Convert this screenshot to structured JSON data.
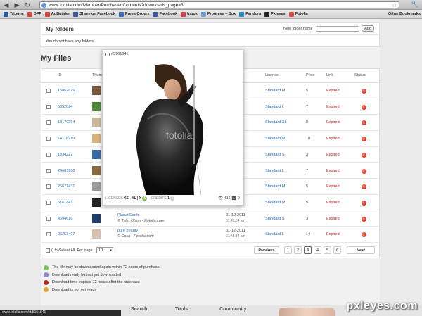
{
  "browser": {
    "url": "www.fotolia.com/Member/PurchasedContents?downloads_page=3",
    "bookmarks": [
      "Tribune",
      "DFP",
      "AdBuilder",
      "Share on Facebook",
      "Press Orders",
      "Facebook",
      "Inbox",
      "Progress – Box",
      "Pandora",
      "Pxleyes",
      "Fotolia"
    ],
    "other_bookmarks": "Other Bookmarks",
    "status_url": "www.fotolia.com/id/5161841"
  },
  "folders": {
    "title": "My folders",
    "new_folder_label": "New folder name",
    "add_label": "Add",
    "empty_text": "You do not have any folders"
  },
  "files": {
    "title": "My Files",
    "columns": {
      "id": "ID",
      "thumbnail": "Thumbnail",
      "license": "License",
      "price": "Price",
      "link": "Link",
      "status": "Status"
    },
    "rows": [
      {
        "id": "15862629",
        "desc": "",
        "author": "",
        "date": "",
        "time": "",
        "license": "Standard M",
        "price": "5",
        "link": "Expired",
        "thumb": "#7a5a3a"
      },
      {
        "id": "6352024",
        "desc": "",
        "author": "",
        "date": "01",
        "time": "",
        "license": "Standard L",
        "price": "7",
        "link": "Expired",
        "thumb": "#4e8a3c"
      },
      {
        "id": "18170394",
        "desc": "",
        "author": "",
        "date": "",
        "time": "",
        "license": "Standard XL",
        "price": "8",
        "link": "Expired",
        "thumb": "#c9b99a"
      },
      {
        "id": "14116279",
        "desc": "",
        "author": "",
        "date": "01",
        "time": "",
        "license": "Standard M",
        "price": "10",
        "link": "Expired",
        "thumb": "#d9b07a"
      },
      {
        "id": "1834227",
        "desc": "",
        "author": "",
        "date": "",
        "time": "",
        "license": "Standard S",
        "price": "3",
        "link": "Expired",
        "thumb": "#3a6aa8"
      },
      {
        "id": "24003900",
        "desc": "",
        "author": "",
        "date": "",
        "time": "",
        "license": "Standard L",
        "price": "7",
        "link": "Expired",
        "thumb": "#8a6a3a"
      },
      {
        "id": "25671431",
        "desc": "",
        "author": "",
        "date": "01",
        "time": "",
        "license": "Standard M",
        "price": "5",
        "link": "Expired",
        "thumb": "#9a9a9a"
      },
      {
        "id": "5161841",
        "desc": "",
        "author": "© diiiz - Fotolia.com",
        "date": "",
        "time": "",
        "license": "Standard M",
        "price": "5",
        "link": "Expired",
        "thumb": "#222222"
      },
      {
        "id": "4694616",
        "desc": "Planet Earth",
        "author": "© Tyler Olson - Fotolia.com",
        "date": "01-12-2011",
        "time": "01:45:34 am",
        "license": "Standard S",
        "price": "3",
        "link": "Expired",
        "thumb": "#1b3b6b"
      },
      {
        "id": "26253407",
        "desc": "pure beauty",
        "author": "© Coka - Fotolia.com",
        "date": "01-12-2011",
        "time": "01:45:34 am",
        "license": "Standard L",
        "price": "14",
        "link": "Expired",
        "thumb": "#d8c0b0"
      }
    ],
    "select_all_label": "(Un)Select All",
    "per_page_label": "Per page",
    "per_page_value": "10",
    "pagination": {
      "previous": "Previous",
      "pages": [
        "1",
        "2",
        "3",
        "4",
        "5",
        "6"
      ],
      "current": "3",
      "next": "Next"
    }
  },
  "legend": [
    {
      "color": "#7cc24f",
      "text": "The file may be downloaded again within 72 hours of purchase."
    },
    {
      "color": "#8f88c8",
      "text": "Download ready but not yet downloaded"
    },
    {
      "color": "#c0271d",
      "text": "Download time expired 72 hours after the purchase"
    },
    {
      "color": "#e2a32a",
      "text": "Download is not yet ready"
    }
  ],
  "bottom_nav": [
    "Search",
    "Tools",
    "Community"
  ],
  "popup": {
    "id_label": "#5161841",
    "licenses_label": "LICENSES",
    "licenses_value": "XS - XL | X",
    "licenses_badge": "5",
    "credits_label": "CREDITS",
    "credits_value": "1",
    "views": "416",
    "downloads": "9",
    "watermark": "fotolia"
  },
  "watermark": "pxleyes.com"
}
